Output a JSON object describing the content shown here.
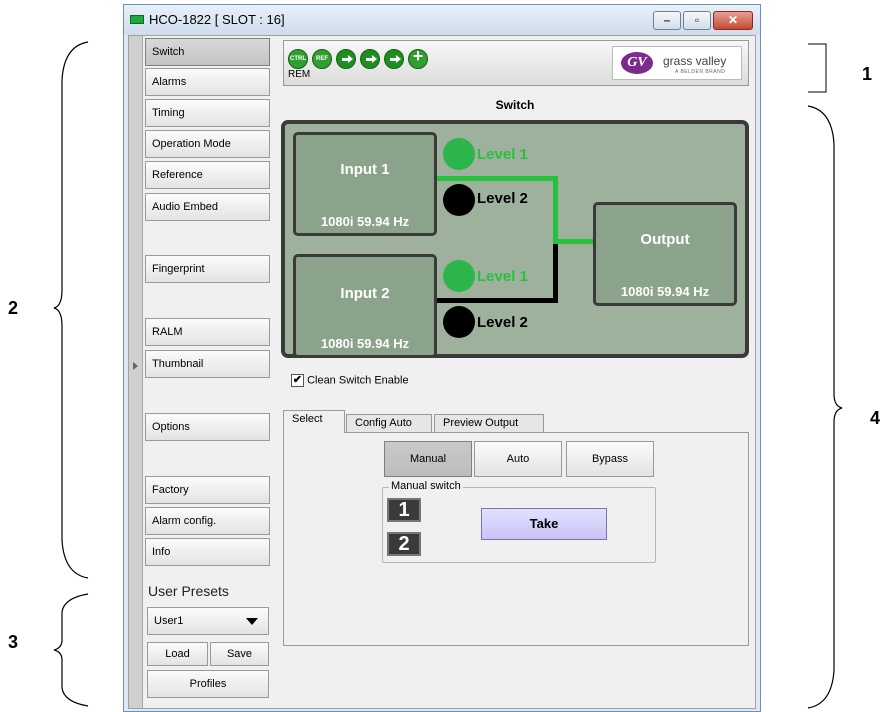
{
  "window": {
    "title": "HCO-1822 [ SLOT : 16]",
    "controls": {
      "minimize": "–",
      "maximize": "▫",
      "close": "✕"
    }
  },
  "callouts": [
    "1",
    "2",
    "3",
    "4"
  ],
  "nav": {
    "items": [
      "Switch",
      "Alarms",
      "Timing",
      "Operation Mode",
      "Reference",
      "Audio Embed",
      "Fingerprint",
      "RALM",
      "Thumbnail",
      "Options",
      "Factory",
      "Alarm config.",
      "Info"
    ],
    "active": "Switch"
  },
  "presets": {
    "label": "User Presets",
    "selected": "User1",
    "load": "Load",
    "save": "Save",
    "profiles": "Profiles"
  },
  "status": {
    "icons": [
      "ctrl-status-icon",
      "ref-status-icon",
      "input1-status-icon",
      "input2-status-icon",
      "output-status-icon",
      "add-status-icon"
    ],
    "ctrl_text": "CTRL",
    "ref_text": "REF",
    "rem_label": "REM",
    "logo_text": "grass valley",
    "logo_sub": "A BELDEN BRAND",
    "logo_mark": "GV"
  },
  "section_title": "Switch",
  "diagram": {
    "input1": {
      "title": "Input 1",
      "format": "1080i 59.94 Hz",
      "level1": "Level 1",
      "level2": "Level 2"
    },
    "input2": {
      "title": "Input 2",
      "format": "1080i 59.94 Hz",
      "level1": "Level 1",
      "level2": "Level 2"
    },
    "output": {
      "title": "Output",
      "format": "1080i 59.94 Hz"
    },
    "colors": {
      "active": "#27c23d",
      "inactive": "#000000",
      "panel": "#9db19d",
      "box": "#8aa38a"
    }
  },
  "clean_switch": {
    "label": "Clean Switch Enable",
    "checked": true,
    "mark": "✔"
  },
  "tabs": [
    "Select",
    "Config Auto",
    "Preview Output"
  ],
  "active_tab": "Select",
  "modes": {
    "manual": "Manual",
    "auto": "Auto",
    "bypass": "Bypass",
    "selected": "Manual"
  },
  "manual_switch": {
    "label": "Manual switch",
    "btn1": "1",
    "btn2": "2",
    "take": "Take"
  }
}
